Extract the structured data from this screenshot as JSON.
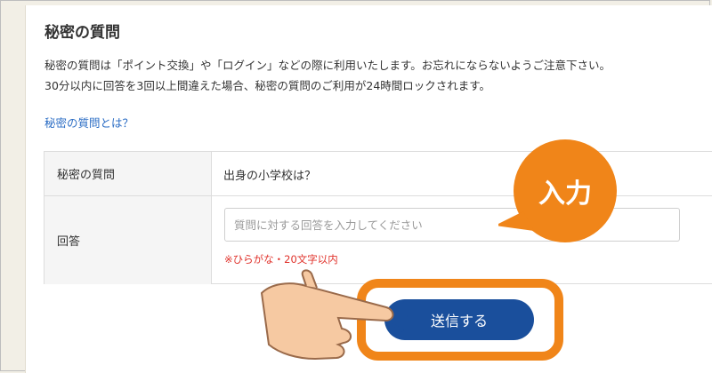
{
  "section": {
    "title": "秘密の質問",
    "desc_line1": "秘密の質問は「ポイント交換」や「ログイン」などの際に利用いたします。お忘れにならないようご注意下さい。",
    "desc_line2": "30分以内に回答を3回以上間違えた場合、秘密の質問のご利用が24時間ロックされます。",
    "help_link": "秘密の質問とは？"
  },
  "form": {
    "question_label": "秘密の質問",
    "question_value": "出身の小学校は？",
    "answer_label": "回答",
    "answer_placeholder": "質問に対する回答を入力してください",
    "answer_value": "",
    "answer_note": "※ひらがな・20文字以内"
  },
  "submit_label": "送信する",
  "callout": {
    "text": "入力"
  },
  "colors": {
    "accent_orange": "#f08519",
    "button_blue": "#1a4f9c",
    "link_blue": "#2a6cc4",
    "note_red": "#e0322b"
  },
  "icons": {
    "pointer": "pointing-hand-icon"
  }
}
